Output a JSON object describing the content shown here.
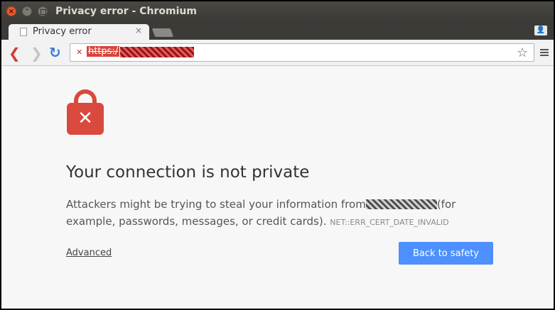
{
  "window": {
    "title": "Privacy error - Chromium",
    "close_glyph": "×",
    "min_glyph": "–"
  },
  "tab": {
    "title": "Privacy error",
    "close_glyph": "×"
  },
  "toolbar": {
    "back_glyph": "❮",
    "forward_glyph": "❯",
    "reload_glyph": "↻",
    "url_icon_glyph": "✕",
    "url_text": "https:/",
    "star_glyph": "☆",
    "profile_glyph": "👤"
  },
  "content": {
    "lock_glyph": "✕",
    "heading": "Your connection is not private",
    "paragraph_before": "Attackers might be trying to steal your information from",
    "paragraph_after": "(for example, passwords, messages, or credit cards).",
    "error_code": "NET::ERR_CERT_DATE_INVALID",
    "advanced_label": "Advanced",
    "back_button_label": "Back to safety"
  },
  "colors": {
    "accent_button": "#4d90fe",
    "lock": "#d9493d",
    "titlebar": "#3c3b37"
  }
}
